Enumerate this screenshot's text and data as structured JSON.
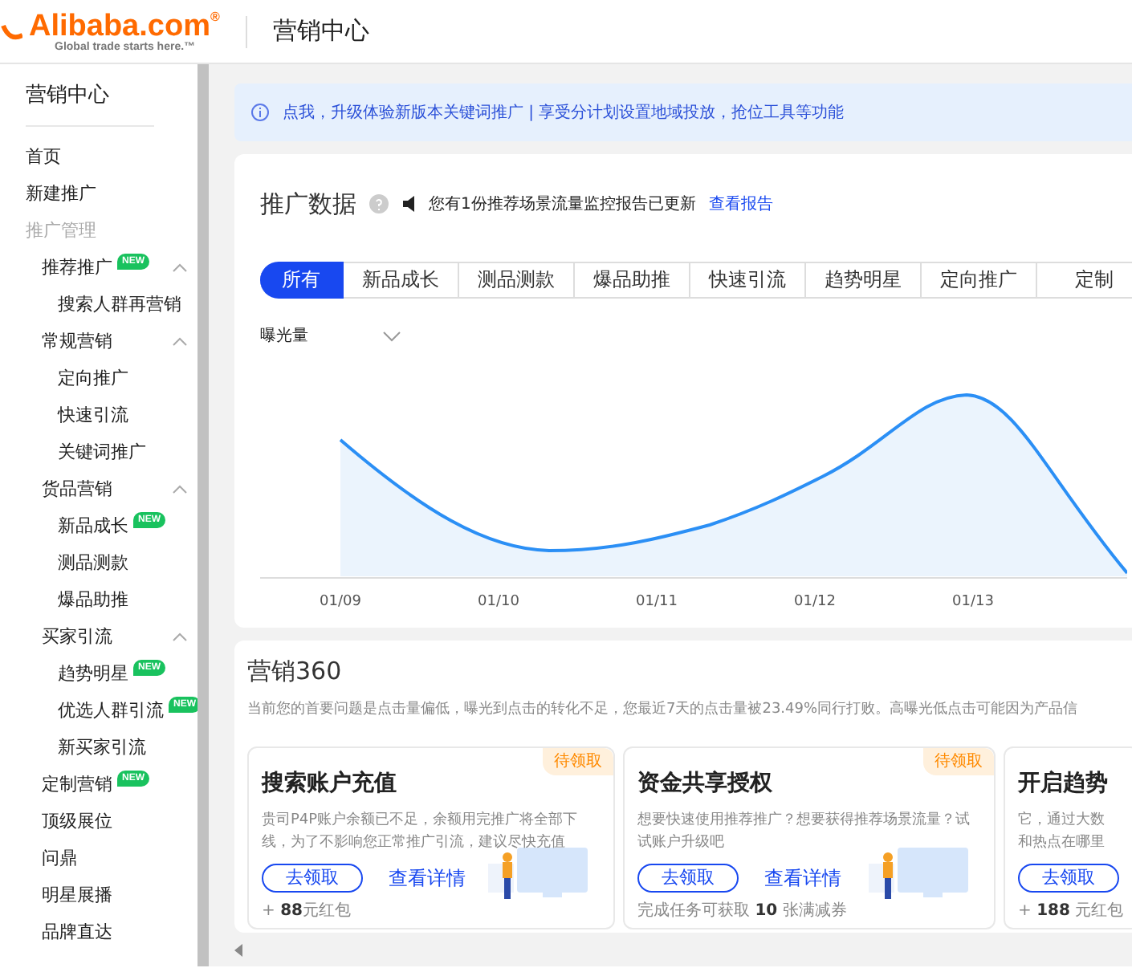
{
  "header": {
    "logo": "Alibaba.com",
    "logo_mark": "®",
    "tagline": "Global trade starts here.™",
    "title": "营销中心"
  },
  "sidebar": {
    "title": "营销中心",
    "nav": [
      {
        "label": "首页"
      },
      {
        "label": "新建推广"
      }
    ],
    "section": "推广管理",
    "items": [
      {
        "label": "推荐推广",
        "badge": "NEW",
        "expanded": true,
        "children": [
          {
            "label": "搜索人群再营销"
          }
        ]
      },
      {
        "label": "常规营销",
        "expanded": true,
        "children": [
          {
            "label": "定向推广"
          },
          {
            "label": "快速引流"
          },
          {
            "label": "关键词推广"
          }
        ]
      },
      {
        "label": "货品营销",
        "expanded": true,
        "children": [
          {
            "label": "新品成长",
            "badge": "NEW"
          },
          {
            "label": "测品测款"
          },
          {
            "label": "爆品助推"
          }
        ]
      },
      {
        "label": "买家引流",
        "expanded": true,
        "children": [
          {
            "label": "趋势明星",
            "badge": "NEW"
          },
          {
            "label": "优选人群引流",
            "badge": "NEW"
          },
          {
            "label": "新买家引流"
          }
        ]
      },
      {
        "label": "定制营销",
        "badge": "NEW"
      },
      {
        "label": "顶级展位"
      },
      {
        "label": "问鼎"
      },
      {
        "label": "明星展播"
      },
      {
        "label": "品牌直达"
      }
    ]
  },
  "banner": {
    "text": "点我，升级体验新版本关键词推广 | 享受分计划设置地域投放，抢位工具等功能"
  },
  "promo_data": {
    "title": "推广数据",
    "notice": "您有1份推荐场景流量监控报告已更新",
    "notice_link": "查看报告",
    "tabs": [
      {
        "label": "所有",
        "selected": true
      },
      {
        "label": "新品成长",
        "selected": false
      },
      {
        "label": "测品测款",
        "selected": false
      },
      {
        "label": "爆品助推",
        "selected": false
      },
      {
        "label": "快速引流",
        "selected": false
      },
      {
        "label": "趋势明星",
        "selected": false
      },
      {
        "label": "定向推广",
        "selected": false
      },
      {
        "label": "定制",
        "selected": false
      }
    ],
    "metric": "曝光量",
    "x_labels": [
      "01/09",
      "01/10",
      "01/11",
      "01/12",
      "01/13"
    ]
  },
  "marketing360": {
    "title": "营销360",
    "summary": "当前您的首要问题是点击量偏低，曝光到点击的转化不足，您最近7天的点击量被23.49%同行打败。高曝光低点击可能因为产品信",
    "cards": [
      {
        "title": "搜索账户充值",
        "tag": "待领取",
        "description": "贵司P4P账户余额已不足，余额用完推广将全部下线，为了不影响您正常推广引流，建议尽快充值",
        "button": "去领取",
        "link": "查看详情",
        "footer": "+ **88**元红包"
      },
      {
        "title": "资金共享授权",
        "tag": "待领取",
        "description": "想要快速使用推荐推广？想要获得推荐场景流量？试试账户升级吧",
        "button": "去领取",
        "link": "查看详情",
        "footer": "完成任务可获取 **10** 张满减券"
      },
      {
        "title": "开启趋势",
        "description": "它，通过大数和热点在哪里",
        "button": "去领取",
        "footer": "+ **188** 元红包"
      }
    ]
  }
}
